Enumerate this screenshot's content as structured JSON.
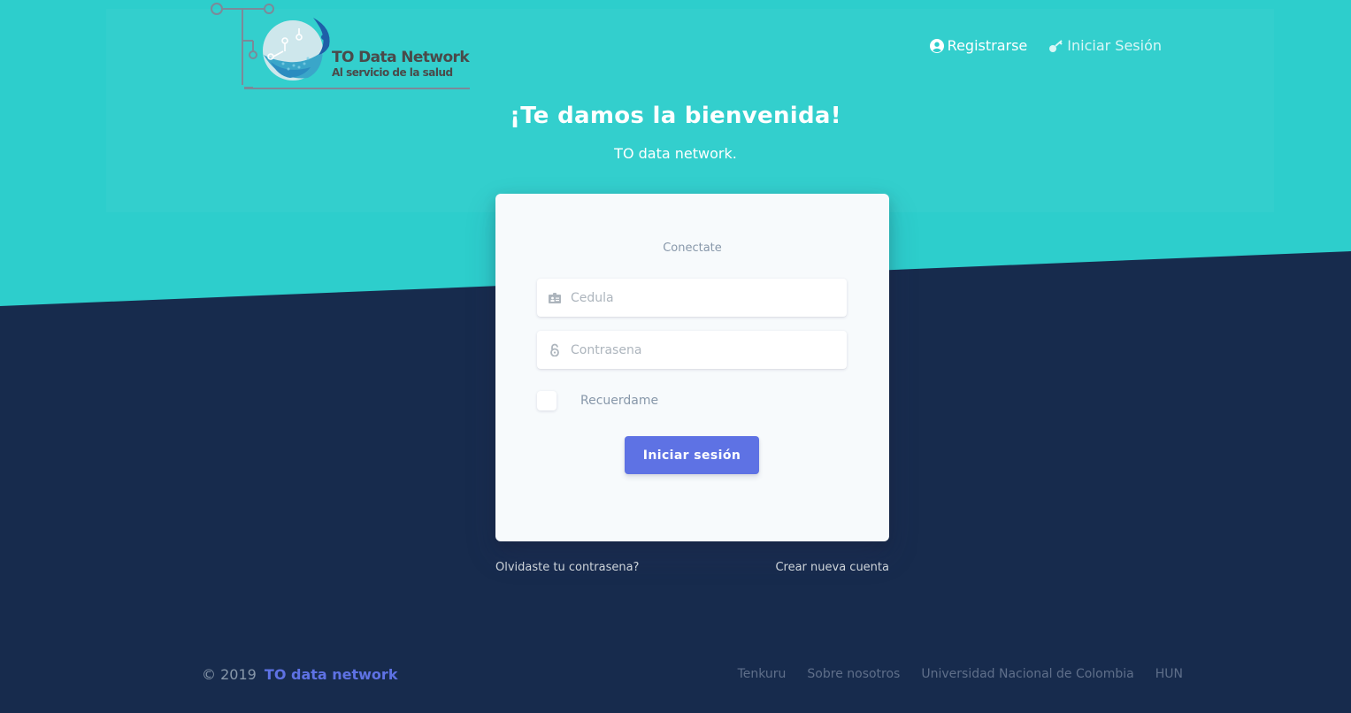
{
  "colors": {
    "teal": "#2dcecc",
    "navy": "#172b4d",
    "primary": "#5e72e4",
    "card": "#f7fafc"
  },
  "logo": {
    "title": "TO Data Network",
    "subtitle": "Al servicio de la salud"
  },
  "nav": {
    "register": {
      "label": "Registrarse",
      "icon": "user-circle-icon"
    },
    "login": {
      "label": "Iniciar Sesión",
      "icon": "key-icon"
    }
  },
  "hero": {
    "title": "¡Te damos la bienvenida!",
    "subtitle": "TO data network."
  },
  "form": {
    "title": "Conectate",
    "cedula": {
      "placeholder": "Cedula",
      "value": "",
      "icon": "id-card-icon"
    },
    "password": {
      "placeholder": "Contrasena",
      "value": "",
      "icon": "lock-icon"
    },
    "remember_label": "Recuerdame",
    "submit_label": "Iniciar sesión"
  },
  "links": {
    "forgot": "Olvidaste tu contrasena?",
    "create": "Crear nueva cuenta"
  },
  "footer": {
    "copyright_prefix": "© 2019",
    "brand": "TO data network",
    "links": [
      "Tenkuru",
      "Sobre nosotros",
      "Universidad Nacional de Colombia",
      "HUN"
    ]
  }
}
